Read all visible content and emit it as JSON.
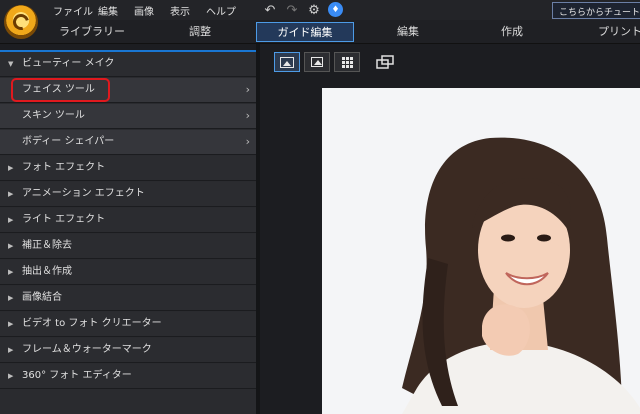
{
  "menu": [
    "ファイル",
    "編集",
    "画像",
    "表示",
    "ヘルプ"
  ],
  "toolbar": {
    "undo_icon": "undo-arrow-icon",
    "redo_icon": "redo-arrow-icon",
    "settings_icon": "gear-icon",
    "notify_icon": "bell-icon",
    "tutorial_label": "こちらからチュートリアル"
  },
  "modes": [
    "ライブラリー",
    "調整",
    "ガイド編集",
    "編集",
    "作成",
    "プリント"
  ],
  "active_mode": "ガイド編集",
  "panel": {
    "expanded_category": "ビューティー メイク",
    "sub_items": [
      "フェイス ツール",
      "スキン ツール",
      "ボディー シェイパー"
    ],
    "highlighted_item": "フェイス ツール",
    "categories": [
      "フォト エフェクト",
      "アニメーション エフェクト",
      "ライト エフェクト",
      "補正＆除去",
      "抽出＆作成",
      "画像結合",
      "ビデオ to フォト クリエーター",
      "フレーム＆ウォーターマーク",
      "360° フォト エディター"
    ]
  },
  "view_buttons": [
    "single-view-icon",
    "image-view-icon",
    "grid-view-icon"
  ],
  "compare_icon": "compare-window-icon",
  "colors": {
    "accent_blue": "#1976d2",
    "highlight_red": "#e0191e",
    "panel_bg": "#2a2b2f",
    "photo_bg": "#f4f5f7"
  }
}
